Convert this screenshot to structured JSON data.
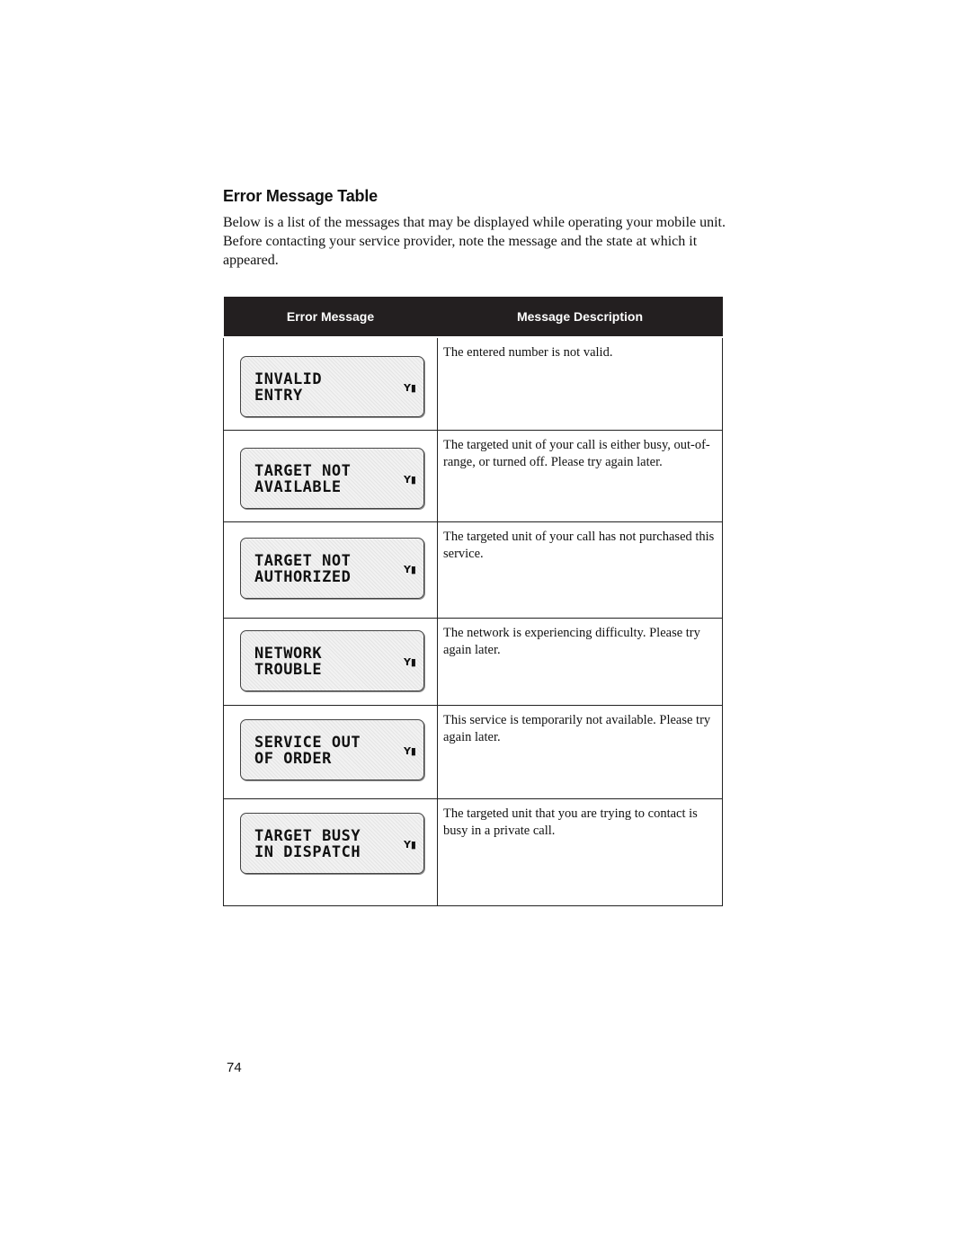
{
  "title": "Error Message Table",
  "intro": "Below is a list of the messages that may be displayed while operating your mobile unit. Before contacting your service provider, note the message and the state at which it appeared.",
  "table": {
    "headers": [
      "Error Message",
      "Message Description"
    ],
    "rows": [
      {
        "display": "INVALID\nENTRY",
        "description": "The entered number is not valid."
      },
      {
        "display": "TARGET NOT\nAVAILABLE",
        "description": "The targeted unit of your call is either busy, out-of-range, or turned off. Please try again later."
      },
      {
        "display": "TARGET NOT\nAUTHORIZED",
        "description": "The targeted unit of your call has not purchased this service."
      },
      {
        "display": "NETWORK\nTROUBLE",
        "description": "The network is experiencing difficulty. Please try again later."
      },
      {
        "display": "SERVICE OUT\nOF ORDER",
        "description": "This service is temporarily not available. Please try again later."
      },
      {
        "display": "TARGET BUSY\nIN DISPATCH",
        "description": "The targeted unit that you are trying to contact is busy in a private call."
      }
    ]
  },
  "display_icon": "signal-strength-icon",
  "page_number": "74"
}
